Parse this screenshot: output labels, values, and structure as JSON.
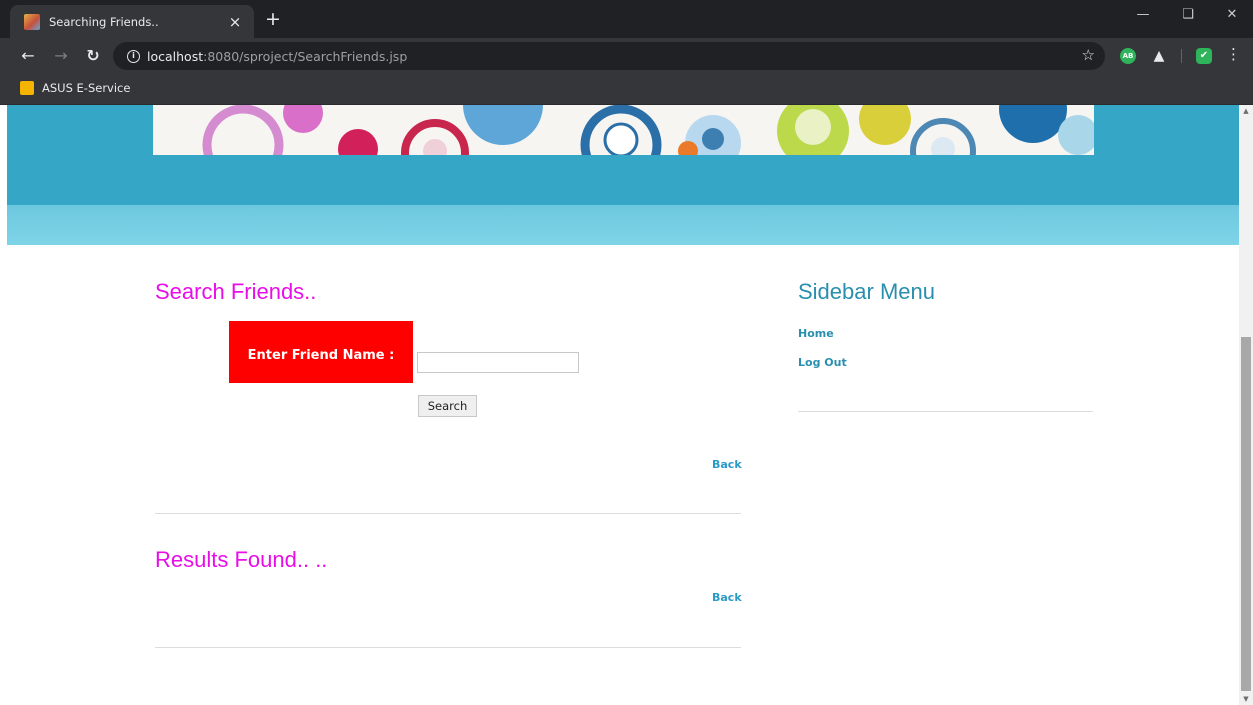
{
  "browser": {
    "tab_title": "Searching Friends..",
    "tab_close": "×",
    "new_tab": "+",
    "url_host": "localhost",
    "url_rest": ":8080/sproject/SearchFriends.jsp",
    "bookmark_label": "ASUS E-Service",
    "extension_ab_label": "AB"
  },
  "search": {
    "heading": "Search Friends..",
    "name_label": "Enter Friend Name :",
    "name_value": "",
    "button_label": "Search",
    "back_label": "Back"
  },
  "results": {
    "heading": "Results Found.. ..",
    "back_label": "Back"
  },
  "sidebar": {
    "title": "Sidebar Menu",
    "items": [
      {
        "label": "Home"
      },
      {
        "label": "Log Out"
      }
    ]
  },
  "colors": {
    "heading": "#e80ee8",
    "label_cell": "#ff0000",
    "link": "#2a9bc7",
    "header_band": "#35a6c6",
    "menu_band": "#7fd4e7"
  }
}
